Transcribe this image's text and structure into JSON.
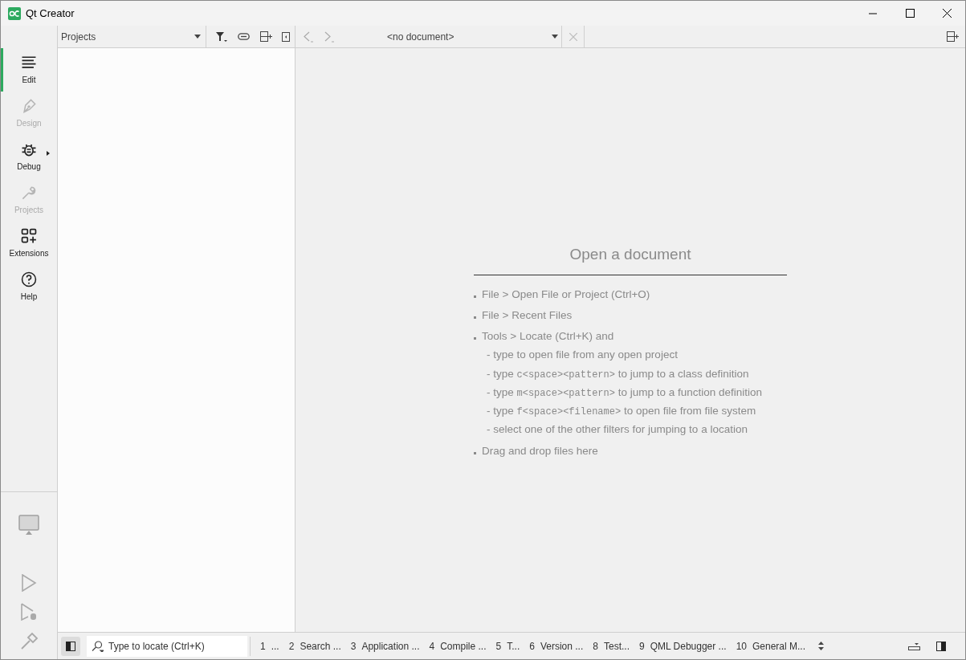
{
  "window": {
    "title": "Qt Creator"
  },
  "modes": [
    {
      "label": "Edit",
      "kind": "edit",
      "selected": true,
      "disabled": false,
      "has_menu": false
    },
    {
      "label": "Design",
      "kind": "design",
      "selected": false,
      "disabled": true,
      "has_menu": false
    },
    {
      "label": "Debug",
      "kind": "debug",
      "selected": false,
      "disabled": false,
      "has_menu": true
    },
    {
      "label": "Projects",
      "kind": "projects",
      "selected": false,
      "disabled": true,
      "has_menu": false
    },
    {
      "label": "Extensions",
      "kind": "extensions",
      "selected": false,
      "disabled": false,
      "has_menu": false
    },
    {
      "label": "Help",
      "kind": "help",
      "selected": false,
      "disabled": false,
      "has_menu": false
    }
  ],
  "project_pane": {
    "view": "Projects"
  },
  "editor_toolbar": {
    "document": "<no document>"
  },
  "welcome": {
    "title": "Open a document",
    "items": [
      {
        "text": "File > Open File or Project (Ctrl+O)"
      },
      {
        "text": "File > Recent Files"
      },
      {
        "text": "Tools > Locate (Ctrl+K) and",
        "sub": [
          {
            "before": "- type to open file from any open project"
          },
          {
            "before": "- type ",
            "code": "c<space><pattern>",
            "after": " to jump to a class definition"
          },
          {
            "before": "- type ",
            "code": "m<space><pattern>",
            "after": " to jump to a function definition"
          },
          {
            "before": "- type ",
            "code": "f<space><filename>",
            "after": " to open file from file system"
          },
          {
            "before": "- select one of the other filters for jumping to a location"
          }
        ]
      },
      {
        "text": "Drag and drop files here"
      }
    ]
  },
  "locator": {
    "placeholder": "Type to locate (Ctrl+K)"
  },
  "output_panes": [
    {
      "number": "1",
      "label": "..."
    },
    {
      "number": "2",
      "label": "Search ..."
    },
    {
      "number": "3",
      "label": "Application ..."
    },
    {
      "number": "4",
      "label": "Compile ..."
    },
    {
      "number": "5",
      "label": "T..."
    },
    {
      "number": "6",
      "label": "Version ..."
    },
    {
      "number": "8",
      "label": "Test..."
    },
    {
      "number": "9",
      "label": "QML Debugger ..."
    },
    {
      "number": "10",
      "label": "General M..."
    }
  ]
}
